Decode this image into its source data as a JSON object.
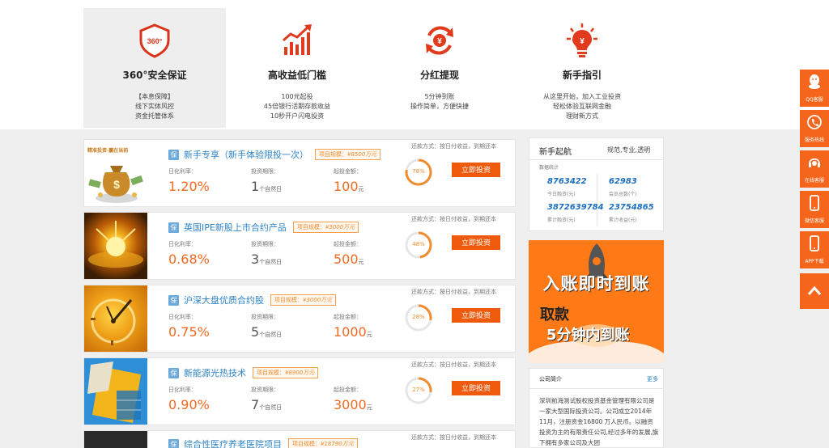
{
  "features": [
    {
      "title": "360°安全保证",
      "icon_text": "360°",
      "lines": [
        "【本息保障】",
        "线下实体风控",
        "资金托管体系"
      ]
    },
    {
      "title": "高收益低门槛",
      "lines": [
        "100元起投",
        "45倍银行活期存款收益",
        "10秒开户闪电投资"
      ]
    },
    {
      "title": "分红提现",
      "icon_text": "¥",
      "lines": [
        "5分钟到账",
        "操作简单，方便快捷"
      ]
    },
    {
      "title": "新手指引",
      "icon_text": "¥",
      "lines": [
        "从这里开始，加入工业投资",
        "轻松体验互联网金融",
        "理财新方式"
      ]
    }
  ],
  "labels": {
    "rate": "日化利率：",
    "period": "投资期限：",
    "min": "起投金额：",
    "repay": "还款方式：按日付收益，到期还本",
    "invest": "立即投资",
    "bao": "保",
    "scale_prefix": "项目规模：",
    "pct_unit": "%",
    "day_unit": "个自然日",
    "yuan_unit": "元"
  },
  "thumb_text": "精准投资·赢在当前",
  "products": [
    {
      "name": "新手专享（新手体验限投一次）",
      "scale": "¥8500万元",
      "rate": "1.20",
      "days": "1",
      "min": "100",
      "progress": 78,
      "progress_label": "78%"
    },
    {
      "name": "英国IPE新股上市合约产品",
      "scale": "¥3000万元",
      "rate": "0.68",
      "days": "3",
      "min": "500",
      "progress": 48,
      "progress_label": "48%"
    },
    {
      "name": "沪深大盘优质合约股",
      "scale": "¥3000万元",
      "rate": "0.75",
      "days": "5",
      "min": "1000",
      "progress": 28,
      "progress_label": "28%"
    },
    {
      "name": "新能源光热技术",
      "scale": "¥8900万元",
      "rate": "0.90",
      "days": "7",
      "min": "3000",
      "progress": 27,
      "progress_label": "27%"
    },
    {
      "name": "综合性医疗养老医院项目",
      "scale": "¥18790万元",
      "rate": "",
      "days": "",
      "min": "",
      "progress": 0,
      "progress_label": ""
    }
  ],
  "nav": {
    "title": "新手起航",
    "slogan": "规范,专业,透明",
    "sub": "数据统计",
    "stats": [
      {
        "value": "8763422",
        "label": "今日融资(元)"
      },
      {
        "value": "62983",
        "label": "会员总数(个)"
      },
      {
        "value": "3872639784",
        "label": "累计融资(元)"
      },
      {
        "value": "23754865",
        "label": "累计收益(元)"
      }
    ]
  },
  "banner": {
    "line1": "入账即时到账",
    "line2": "取款",
    "line3": "5分钟内到账"
  },
  "company": {
    "title": "公司简介",
    "more": "更多",
    "body": "深圳前海测试股权投资基金管理有限公司是一家大型国际投资公司。公司成立2014年11月，注册资金16800 万人民币。以融资投资为主的有限责任公司,经过多年的发展,旗下拥有多家公司及大团"
  },
  "float": [
    {
      "label": "QQ客服",
      "icon": "qq-icon"
    },
    {
      "label": "服务热线",
      "icon": "phone-icon"
    },
    {
      "label": "在线客服",
      "icon": "headset-icon"
    },
    {
      "label": "微信客服",
      "icon": "mobile-icon"
    },
    {
      "label": "APP下载",
      "icon": "mobile-icon"
    },
    {
      "label": "",
      "icon": "chevron-up-icon"
    }
  ],
  "colors": {
    "accent": "#f05a0c",
    "link": "#2e84c8",
    "number": "#1b6fbf"
  }
}
